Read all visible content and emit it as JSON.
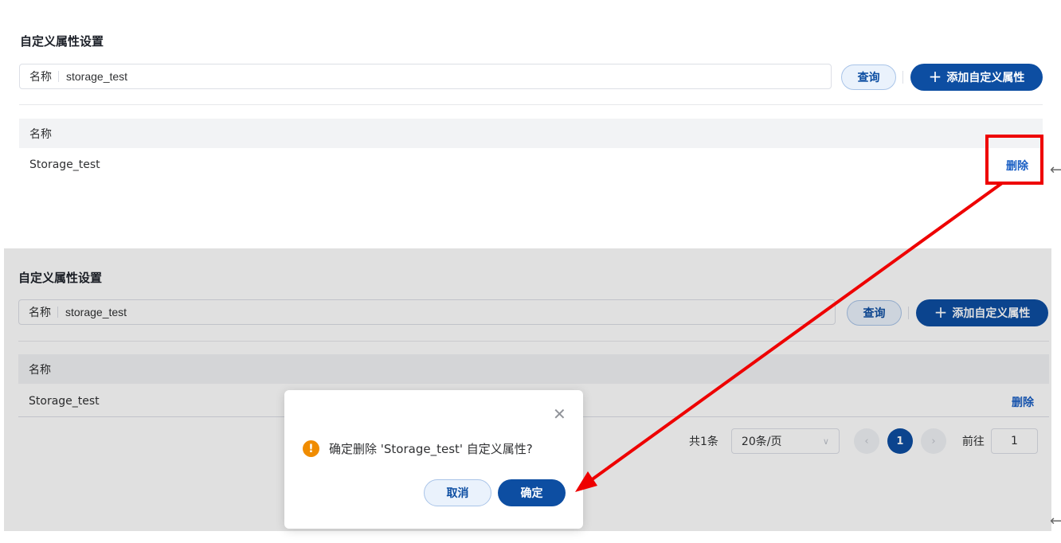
{
  "top": {
    "title": "自定义属性设置",
    "search_label": "名称",
    "search_value": "storage_test",
    "query_label": "查询",
    "add_label": "添加自定义属性",
    "column_name": "名称",
    "row_name": "Storage_test",
    "delete_label": "删除"
  },
  "bottom": {
    "title": "自定义属性设置",
    "search_label": "名称",
    "search_value": "storage_test",
    "query_label": "查询",
    "add_label": "添加自定义属性",
    "column_name": "名称",
    "row_name": "Storage_test",
    "delete_label": "删除",
    "pager": {
      "total": "共1条",
      "page_size": "20条/页",
      "current": "1",
      "goto_label": "前往",
      "goto_value": "1"
    }
  },
  "dialog": {
    "message": "确定删除 'Storage_test' 自定义属性?",
    "cancel_label": "取消",
    "ok_label": "确定"
  },
  "colors": {
    "primary": "#0d4ea2",
    "annotation": "#ee0000",
    "warning": "#f08c00"
  },
  "icons": [
    "plus-icon",
    "close-icon",
    "warning-icon",
    "chevron-down-icon",
    "chevron-left-icon",
    "chevron-right-icon",
    "arrow-left-icon"
  ]
}
